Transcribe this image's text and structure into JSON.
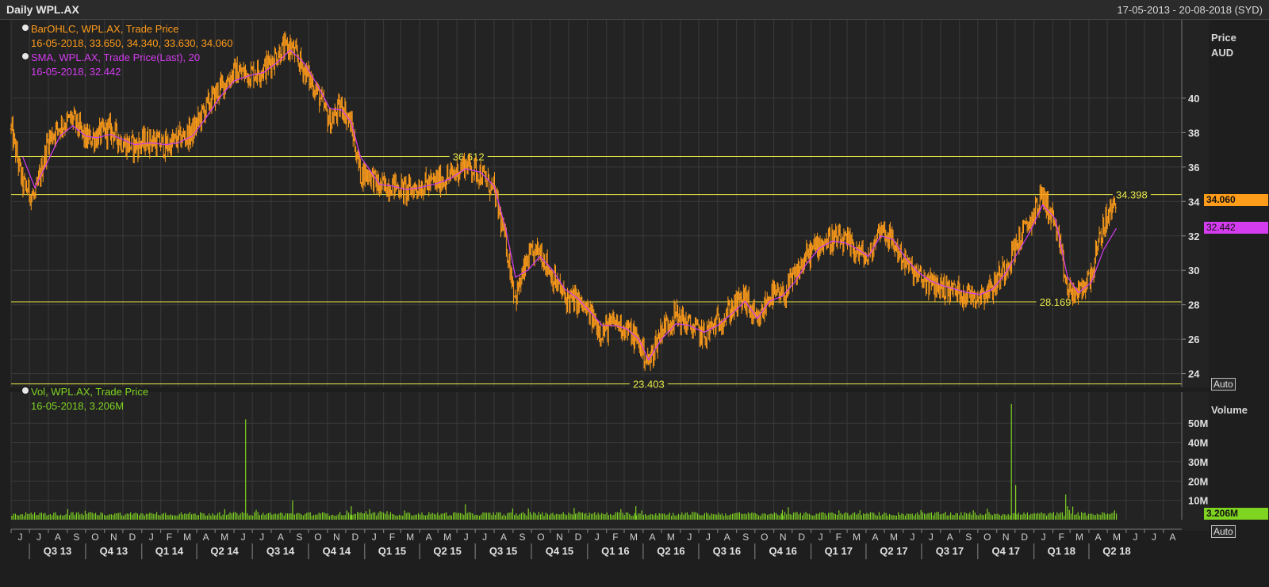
{
  "header": {
    "title": "Daily WPL.AX",
    "date_range": "17-05-2013 - 20-08-2018 (SYD)"
  },
  "legend": {
    "ohlc_title": "BarOHLC, WPL.AX, Trade Price",
    "ohlc_values": "16-05-2018, 33.650, 34.340, 33.630, 34.060",
    "sma_title": "SMA, WPL.AX, Trade Price(Last),  20",
    "sma_values": "16-05-2018, 32.442",
    "vol_title": "Vol, WPL.AX, Trade Price",
    "vol_values": "16-05-2018, 3.206M"
  },
  "axis": {
    "price_title_1": "Price",
    "price_title_2": "AUD",
    "volume_title": "Volume",
    "auto_label": "Auto"
  },
  "tags": {
    "last_price": "34.060",
    "sma_last": "32.442",
    "last_volume": "3.206M"
  },
  "colors": {
    "price": "#ff9c1a",
    "sma": "#d43cf0",
    "volume": "#7fd321",
    "hline": "#e8e84a",
    "grid": "#3a3a3a"
  },
  "chart_data": {
    "type": "line",
    "x_range": [
      "2013-06-01",
      "2018-08-31"
    ],
    "price_axis": {
      "ylim": [
        23.2,
        44
      ],
      "ticks": [
        24,
        26,
        28,
        30,
        32,
        34,
        36,
        38,
        40
      ]
    },
    "volume_axis": {
      "ylim": [
        0,
        62
      ],
      "ticks": [
        10,
        20,
        30,
        40,
        50
      ],
      "tick_labels": [
        "10M",
        "20M",
        "30M",
        "40M",
        "50M"
      ]
    },
    "horizontal_lines": [
      {
        "value": 36.612,
        "label": "36.612",
        "label_date": "2015-06-20"
      },
      {
        "value": 34.398,
        "label": "34.398",
        "label_date": "2018-06-10"
      },
      {
        "value": 28.169,
        "label": "28.169",
        "label_date": "2018-02-05"
      },
      {
        "value": 23.403,
        "label": "23.403",
        "label_date": "2016-04-10"
      }
    ],
    "series": [
      {
        "name": "BarOHLC, WPL.AX, Trade Price",
        "x": [
          "2013-06-01",
          "2013-06-20",
          "2013-07-10",
          "2013-08-01",
          "2013-08-20",
          "2013-09-10",
          "2013-10-01",
          "2013-10-20",
          "2013-11-10",
          "2013-12-01",
          "2013-12-20",
          "2014-01-15",
          "2014-02-10",
          "2014-03-01",
          "2014-03-25",
          "2014-04-15",
          "2014-05-10",
          "2014-06-01",
          "2014-06-25",
          "2014-07-20",
          "2014-08-15",
          "2014-09-01",
          "2014-09-25",
          "2014-10-15",
          "2014-11-05",
          "2014-11-25",
          "2014-12-10",
          "2014-12-25",
          "2015-01-10",
          "2015-01-25",
          "2015-02-15",
          "2015-03-10",
          "2015-04-01",
          "2015-04-25",
          "2015-05-20",
          "2015-06-15",
          "2015-07-10",
          "2015-08-01",
          "2015-08-20",
          "2015-09-05",
          "2015-09-25",
          "2015-10-15",
          "2015-11-05",
          "2015-11-25",
          "2015-12-15",
          "2016-01-05",
          "2016-01-25",
          "2016-02-15",
          "2016-03-05",
          "2016-03-25",
          "2016-04-10",
          "2016-05-01",
          "2016-05-25",
          "2016-06-15",
          "2016-07-10",
          "2016-08-01",
          "2016-08-25",
          "2016-09-15",
          "2016-10-05",
          "2016-10-25",
          "2016-11-15",
          "2016-12-05",
          "2016-12-25",
          "2017-01-15",
          "2017-02-05",
          "2017-02-25",
          "2017-03-15",
          "2017-04-05",
          "2017-04-25",
          "2017-05-15",
          "2017-06-05",
          "2017-06-25",
          "2017-07-15",
          "2017-08-05",
          "2017-08-25",
          "2017-09-15",
          "2017-10-05",
          "2017-10-25",
          "2017-11-15",
          "2017-12-05",
          "2017-12-25",
          "2018-01-15",
          "2018-02-05",
          "2018-02-25",
          "2018-03-15",
          "2018-04-05",
          "2018-04-25",
          "2018-05-16"
        ],
        "values": [
          38.2,
          35.0,
          34.2,
          37.6,
          38.4,
          38.8,
          37.6,
          37.8,
          38.2,
          37.4,
          37.2,
          37.6,
          37.2,
          37.6,
          38.0,
          39.4,
          40.6,
          41.5,
          41.4,
          41.7,
          42.7,
          43.0,
          41.6,
          40.4,
          38.6,
          39.6,
          38.4,
          35.6,
          35.6,
          34.8,
          35.0,
          34.6,
          34.9,
          35.1,
          35.4,
          36.2,
          35.6,
          34.6,
          31.6,
          28.4,
          30.6,
          31.2,
          29.6,
          28.4,
          28.2,
          27.4,
          26.4,
          27.0,
          26.6,
          25.8,
          24.6,
          26.6,
          27.4,
          26.8,
          26.2,
          27.0,
          27.8,
          28.4,
          26.8,
          28.6,
          28.4,
          29.6,
          30.8,
          31.6,
          31.8,
          31.6,
          31.2,
          30.6,
          32.6,
          31.6,
          30.4,
          29.6,
          29.2,
          29.0,
          28.8,
          28.6,
          28.6,
          29.0,
          30.2,
          31.6,
          32.8,
          34.4,
          32.6,
          28.8,
          28.6,
          29.8,
          32.6,
          34.06
        ]
      },
      {
        "name": "SMA, WPL.AX, Trade Price(Last),  20",
        "x": [
          "2013-06-20",
          "2013-07-10",
          "2013-08-01",
          "2013-08-20",
          "2013-09-10",
          "2013-10-01",
          "2013-10-20",
          "2013-11-10",
          "2013-12-01",
          "2013-12-20",
          "2014-01-15",
          "2014-02-10",
          "2014-03-01",
          "2014-03-25",
          "2014-04-15",
          "2014-05-10",
          "2014-06-01",
          "2014-06-25",
          "2014-07-20",
          "2014-08-15",
          "2014-09-01",
          "2014-09-25",
          "2014-10-15",
          "2014-11-05",
          "2014-11-25",
          "2014-12-10",
          "2014-12-25",
          "2015-01-10",
          "2015-01-25",
          "2015-02-15",
          "2015-03-10",
          "2015-04-01",
          "2015-04-25",
          "2015-05-20",
          "2015-06-15",
          "2015-07-10",
          "2015-08-01",
          "2015-08-20",
          "2015-09-05",
          "2015-09-25",
          "2015-10-15",
          "2015-11-05",
          "2015-11-25",
          "2015-12-15",
          "2016-01-05",
          "2016-01-25",
          "2016-02-15",
          "2016-03-05",
          "2016-03-25",
          "2016-04-10",
          "2016-05-01",
          "2016-05-25",
          "2016-06-15",
          "2016-07-10",
          "2016-08-01",
          "2016-08-25",
          "2016-09-15",
          "2016-10-05",
          "2016-10-25",
          "2016-11-15",
          "2016-12-05",
          "2016-12-25",
          "2017-01-15",
          "2017-02-05",
          "2017-02-25",
          "2017-03-15",
          "2017-04-05",
          "2017-04-25",
          "2017-05-15",
          "2017-06-05",
          "2017-06-25",
          "2017-07-15",
          "2017-08-05",
          "2017-08-25",
          "2017-09-15",
          "2017-10-05",
          "2017-10-25",
          "2017-11-15",
          "2017-12-05",
          "2017-12-25",
          "2018-01-15",
          "2018-02-05",
          "2018-02-25",
          "2018-03-15",
          "2018-04-05",
          "2018-04-25",
          "2018-05-16"
        ],
        "values": [
          36.6,
          34.8,
          36.4,
          37.8,
          38.4,
          37.8,
          37.7,
          37.9,
          37.6,
          37.3,
          37.4,
          37.3,
          37.4,
          37.8,
          38.8,
          40.1,
          41.0,
          41.3,
          41.5,
          42.2,
          42.8,
          42.0,
          40.8,
          39.4,
          39.3,
          38.6,
          36.6,
          35.8,
          35.0,
          34.9,
          34.7,
          34.8,
          35.0,
          35.3,
          35.9,
          35.7,
          34.9,
          32.4,
          29.6,
          30.0,
          30.8,
          30.0,
          28.9,
          28.4,
          27.6,
          26.8,
          26.8,
          26.6,
          26.0,
          24.8,
          26.0,
          26.9,
          26.8,
          26.4,
          26.8,
          27.5,
          28.2,
          27.2,
          28.2,
          28.5,
          29.3,
          30.4,
          31.3,
          31.7,
          31.6,
          31.3,
          30.8,
          32.0,
          31.8,
          30.7,
          29.9,
          29.4,
          29.1,
          28.9,
          28.7,
          28.6,
          28.9,
          29.8,
          31.0,
          32.2,
          33.8,
          33.0,
          29.6,
          28.7,
          29.3,
          31.2,
          32.442
        ]
      },
      {
        "name": "Vol, WPL.AX, Trade Price",
        "x": [
          "2014-06-20",
          "2014-09-05",
          "2014-12-10",
          "2015-06-15",
          "2015-12-10",
          "2016-03-20",
          "2016-11-15",
          "2017-11-25",
          "2017-12-02",
          "2018-02-22",
          "2018-02-25",
          "2018-05-16"
        ],
        "values": [
          52,
          10,
          7,
          8,
          6,
          7,
          5,
          60,
          18,
          13,
          7,
          3.206
        ],
        "baseline_range": [
          2,
          4
        ]
      }
    ],
    "x_month_labels": [
      "J",
      "J",
      "A",
      "S",
      "O",
      "N",
      "D",
      "J",
      "F",
      "M",
      "A",
      "M",
      "J",
      "J",
      "A",
      "S",
      "O",
      "N",
      "D",
      "J",
      "F",
      "M",
      "A",
      "M",
      "J",
      "J",
      "A",
      "S",
      "O",
      "N",
      "D",
      "J",
      "F",
      "M",
      "A",
      "M",
      "J",
      "J",
      "A",
      "S",
      "O",
      "N",
      "D",
      "J",
      "F",
      "M",
      "A",
      "M",
      "J",
      "J",
      "A",
      "S",
      "O",
      "N",
      "D",
      "J",
      "F",
      "M",
      "A",
      "M",
      "J",
      "J",
      "A"
    ],
    "x_quarter_labels": [
      "Q3 13",
      "Q4 13",
      "Q1 14",
      "Q2 14",
      "Q3 14",
      "Q4 14",
      "Q1 15",
      "Q2 15",
      "Q3 15",
      "Q4 15",
      "Q1 16",
      "Q2 16",
      "Q3 16",
      "Q4 16",
      "Q1 17",
      "Q2 17",
      "Q3 17",
      "Q4 17",
      "Q1 18",
      "Q2 18"
    ]
  }
}
